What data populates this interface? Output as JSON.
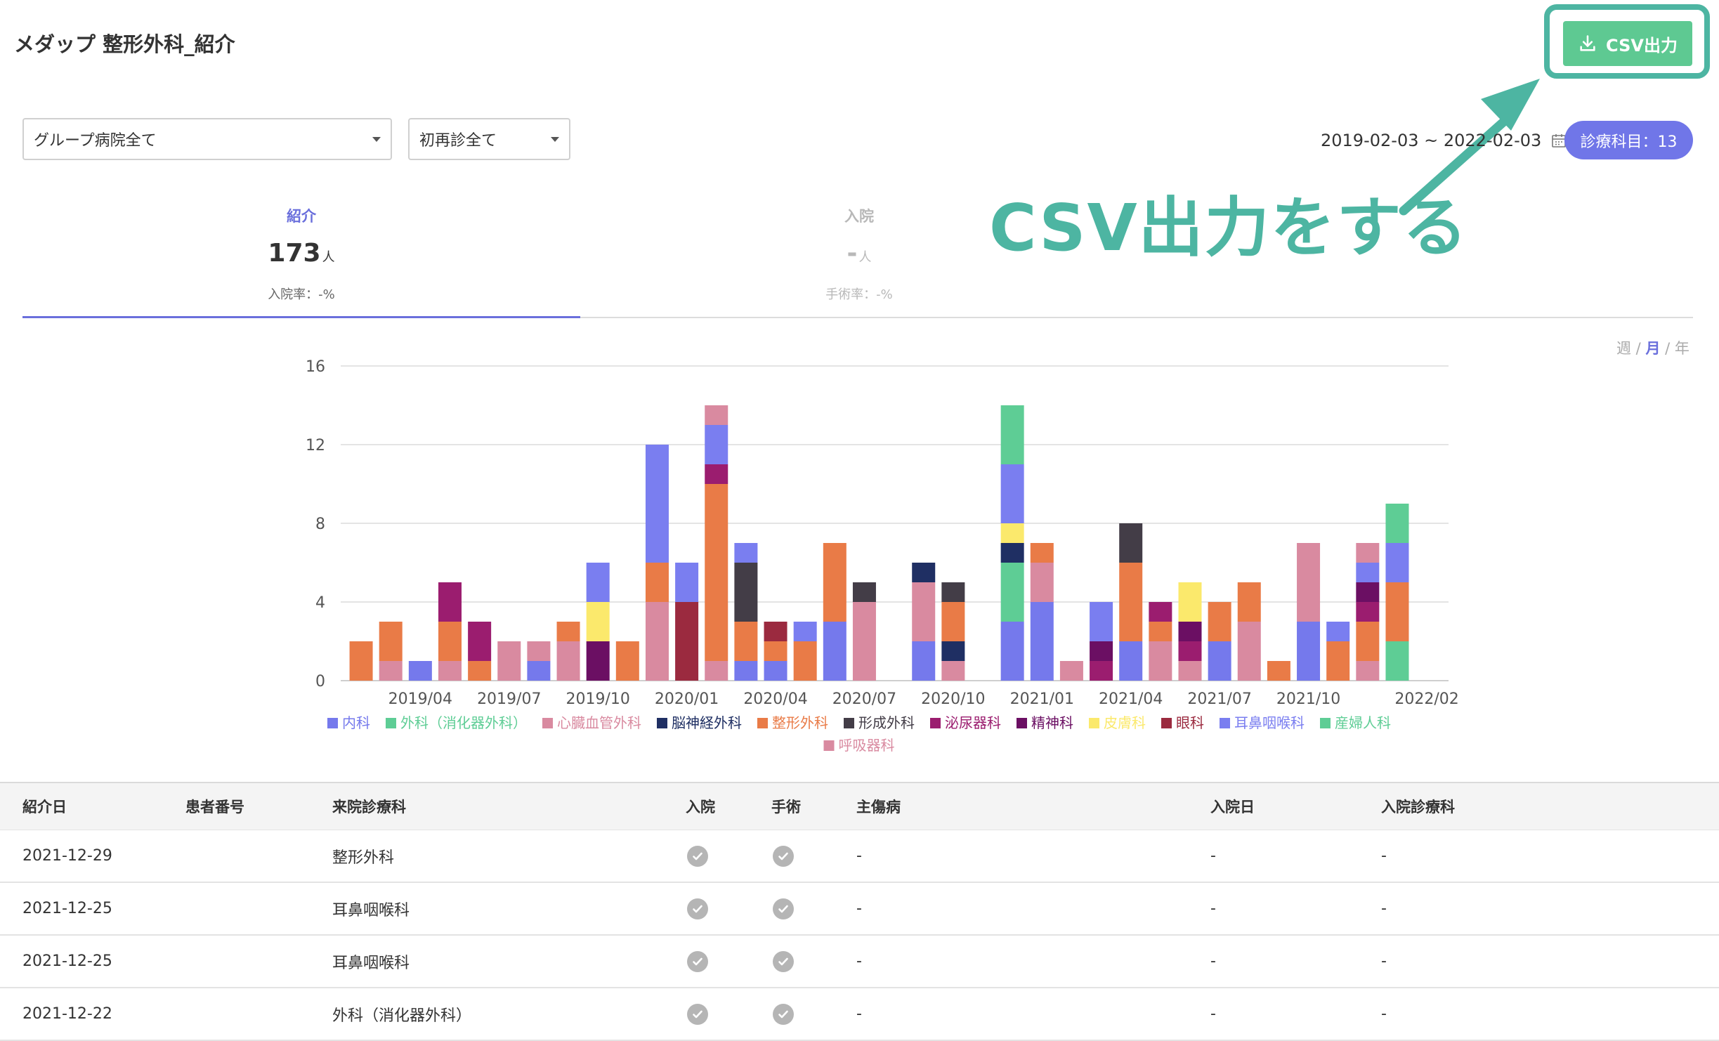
{
  "header": {
    "title": "メダップ 整形外科_紹介",
    "csv_button_label": "CSV出力"
  },
  "annotation": {
    "text": "CSV出力をする"
  },
  "filters": {
    "hospital_group": "グループ病院全て",
    "visit_type": "初再診全て"
  },
  "date_range": {
    "text": "2019-02-03 ~ 2022-02-03"
  },
  "department_badge": {
    "text": "診療科目：13"
  },
  "tabs": [
    {
      "label": "紹介",
      "count": "173",
      "unit": "人",
      "rate": "入院率：-%"
    },
    {
      "label": "入院",
      "count": "-",
      "unit": "人",
      "rate": "手術率：-%"
    }
  ],
  "period_switch": {
    "week": "週",
    "month": "月",
    "year": "年",
    "separator": " / ",
    "active": "month"
  },
  "chart_data": {
    "type": "bar",
    "stacked": true,
    "x": [
      "2019/02",
      "2019/03",
      "2019/04",
      "2019/05",
      "2019/06",
      "2019/07",
      "2019/08",
      "2019/09",
      "2019/10",
      "2019/11",
      "2019/12",
      "2020/01",
      "2020/02",
      "2020/03",
      "2020/04",
      "2020/05",
      "2020/06",
      "2020/07",
      "2020/08",
      "2020/09",
      "2020/10",
      "2020/11",
      "2020/12",
      "2021/01",
      "2021/02",
      "2021/03",
      "2021/04",
      "2021/05",
      "2021/06",
      "2021/07",
      "2021/08",
      "2021/09",
      "2021/10",
      "2021/11",
      "2021/12",
      "2022/01"
    ],
    "x_tick_labels": [
      "2019/04",
      "2019/07",
      "2019/10",
      "2020/01",
      "2020/04",
      "2020/07",
      "2020/10",
      "2021/01",
      "2021/04",
      "2021/07",
      "2021/10",
      "2022/02"
    ],
    "y_ticks": [
      0,
      4,
      8,
      12,
      16
    ],
    "ylim": [
      0,
      16
    ],
    "grid": true,
    "legend_position": "bottom",
    "series": [
      {
        "name": "内科",
        "color": "#7579ec",
        "values": [
          0,
          0,
          1,
          0,
          0,
          0,
          1,
          0,
          0,
          0,
          0,
          0,
          0,
          1,
          1,
          0,
          3,
          0,
          0,
          2,
          0,
          0,
          3,
          4,
          0,
          0,
          2,
          0,
          0,
          2,
          0,
          0,
          3,
          0,
          0,
          0
        ]
      },
      {
        "name": "外科（消化器外科）",
        "color": "#5ecd95",
        "values": [
          0,
          0,
          0,
          0,
          0,
          0,
          0,
          0,
          0,
          0,
          0,
          0,
          0,
          0,
          0,
          0,
          0,
          0,
          0,
          0,
          0,
          0,
          3,
          0,
          0,
          0,
          0,
          0,
          0,
          0,
          0,
          0,
          0,
          0,
          0,
          2
        ]
      },
      {
        "name": "心臓血管外科",
        "color": "#d98aa0",
        "values": [
          0,
          1,
          0,
          1,
          0,
          2,
          1,
          2,
          0,
          0,
          4,
          0,
          1,
          0,
          0,
          0,
          0,
          4,
          0,
          3,
          1,
          0,
          0,
          2,
          1,
          0,
          0,
          2,
          1,
          0,
          3,
          0,
          4,
          0,
          1,
          0
        ]
      },
      {
        "name": "脳神経外科",
        "color": "#1f2f63",
        "values": [
          0,
          0,
          0,
          0,
          0,
          0,
          0,
          0,
          0,
          0,
          0,
          0,
          0,
          0,
          0,
          0,
          0,
          0,
          0,
          1,
          1,
          0,
          1,
          0,
          0,
          0,
          0,
          0,
          0,
          0,
          0,
          0,
          0,
          0,
          0,
          0
        ]
      },
      {
        "name": "整形外科",
        "color": "#e97b47",
        "values": [
          2,
          2,
          0,
          2,
          1,
          0,
          0,
          1,
          0,
          2,
          2,
          0,
          9,
          2,
          1,
          2,
          4,
          0,
          0,
          0,
          2,
          0,
          0,
          1,
          0,
          0,
          4,
          1,
          0,
          2,
          2,
          1,
          0,
          2,
          2,
          3
        ]
      },
      {
        "name": "形成外科",
        "color": "#433d47",
        "values": [
          0,
          0,
          0,
          0,
          0,
          0,
          0,
          0,
          0,
          0,
          0,
          0,
          0,
          3,
          0,
          0,
          0,
          1,
          0,
          0,
          1,
          0,
          0,
          0,
          0,
          0,
          2,
          0,
          0,
          0,
          0,
          0,
          0,
          0,
          0,
          0
        ]
      },
      {
        "name": "泌尿器科",
        "color": "#9b1d6f",
        "values": [
          0,
          0,
          0,
          2,
          2,
          0,
          0,
          0,
          0,
          0,
          0,
          0,
          1,
          0,
          0,
          0,
          0,
          0,
          0,
          0,
          0,
          0,
          0,
          0,
          0,
          1,
          0,
          1,
          1,
          0,
          0,
          0,
          0,
          0,
          1,
          0
        ]
      },
      {
        "name": "精神科",
        "color": "#6b0f63",
        "values": [
          0,
          0,
          0,
          0,
          0,
          0,
          0,
          0,
          2,
          0,
          0,
          0,
          0,
          0,
          0,
          0,
          0,
          0,
          0,
          0,
          0,
          0,
          0,
          0,
          0,
          1,
          0,
          0,
          1,
          0,
          0,
          0,
          0,
          0,
          1,
          0
        ]
      },
      {
        "name": "皮膚科",
        "color": "#fbe96c",
        "values": [
          0,
          0,
          0,
          0,
          0,
          0,
          0,
          0,
          2,
          0,
          0,
          0,
          0,
          0,
          0,
          0,
          0,
          0,
          0,
          0,
          0,
          0,
          1,
          0,
          0,
          0,
          0,
          0,
          2,
          0,
          0,
          0,
          0,
          0,
          0,
          0
        ]
      },
      {
        "name": "眼科",
        "color": "#9b2a3f",
        "values": [
          0,
          0,
          0,
          0,
          0,
          0,
          0,
          0,
          0,
          0,
          0,
          4,
          0,
          0,
          1,
          0,
          0,
          0,
          0,
          0,
          0,
          0,
          0,
          0,
          0,
          0,
          0,
          0,
          0,
          0,
          0,
          0,
          0,
          0,
          0,
          0
        ]
      },
      {
        "name": "耳鼻咽喉科",
        "color": "#7a7ef0",
        "values": [
          0,
          0,
          0,
          0,
          0,
          0,
          0,
          0,
          2,
          0,
          6,
          2,
          2,
          1,
          0,
          1,
          0,
          0,
          0,
          0,
          0,
          0,
          3,
          0,
          0,
          2,
          0,
          0,
          0,
          0,
          0,
          0,
          0,
          1,
          1,
          2
        ]
      },
      {
        "name": "産婦人科",
        "color": "#5ecd95",
        "values": [
          0,
          0,
          0,
          0,
          0,
          0,
          0,
          0,
          0,
          0,
          0,
          0,
          0,
          0,
          0,
          0,
          0,
          0,
          0,
          0,
          0,
          0,
          3,
          0,
          0,
          0,
          0,
          0,
          0,
          0,
          0,
          0,
          0,
          0,
          0,
          2
        ]
      },
      {
        "name": "呼吸器科",
        "color": "#d98aa0",
        "values": [
          0,
          0,
          0,
          0,
          0,
          0,
          0,
          0,
          0,
          0,
          0,
          0,
          1,
          0,
          0,
          0,
          0,
          0,
          0,
          0,
          0,
          0,
          0,
          0,
          0,
          0,
          0,
          0,
          0,
          0,
          0,
          0,
          0,
          0,
          1,
          0
        ]
      }
    ]
  },
  "table": {
    "columns": [
      "紹介日",
      "患者番号",
      "来院診療科",
      "入院",
      "手術",
      "主傷病",
      "入院日",
      "入院診療科"
    ],
    "rows": [
      {
        "date": "2021-12-29",
        "patient_no": "",
        "department": "整形外科",
        "admission": "check",
        "surgery": "check",
        "diagnosis": "-",
        "admission_date": "-",
        "admission_dept": "-"
      },
      {
        "date": "2021-12-25",
        "patient_no": "",
        "department": "耳鼻咽喉科",
        "admission": "check",
        "surgery": "check",
        "diagnosis": "-",
        "admission_date": "-",
        "admission_dept": "-"
      },
      {
        "date": "2021-12-25",
        "patient_no": "",
        "department": "耳鼻咽喉科",
        "admission": "check",
        "surgery": "check",
        "diagnosis": "-",
        "admission_date": "-",
        "admission_dept": "-"
      },
      {
        "date": "2021-12-22",
        "patient_no": "",
        "department": "外科（消化器外科）",
        "admission": "check",
        "surgery": "check",
        "diagnosis": "-",
        "admission_date": "-",
        "admission_dept": "-"
      }
    ]
  }
}
